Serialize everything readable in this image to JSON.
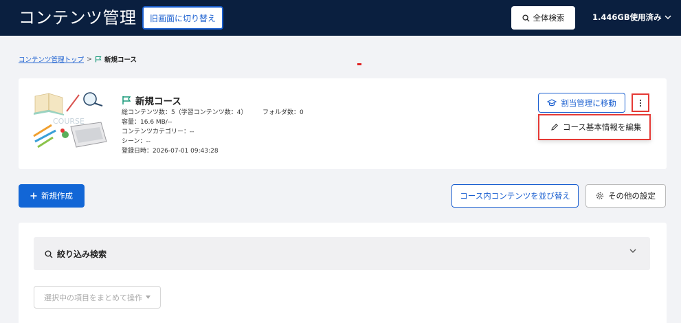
{
  "header": {
    "title": "コンテンツ管理",
    "old_ui_button": "旧画面に切り替え",
    "search_button": "全体検索",
    "usage": "1.446GB使用済み"
  },
  "breadcrumb": {
    "top": "コンテンツ管理トップ",
    "separator": ">",
    "current": "新規コース"
  },
  "course": {
    "name": "新規コース",
    "total_contents": "総コンテンツ数：5（学習コンテンツ数：4）",
    "folders": "フォルダ数：0",
    "capacity": "容量：16.6 MB/--",
    "category": "コンテンツカテゴリー：--",
    "scene": "シーン：--",
    "registered": "登録日時：2026-07-01 09:43:28",
    "thumbnail_text": "COURSE",
    "assign_button": "割当管理に移動",
    "menu_item_edit": "コース基本情報を編集"
  },
  "actions": {
    "new_button": "新規作成",
    "reorder_button": "コース内コンテンツを並び替え",
    "other_settings_button": "その他の設定"
  },
  "filter": {
    "label": "絞り込み検索",
    "bulk_action": "選択中の項目をまとめて操作"
  },
  "colors": {
    "header_bg": "#0a1f3f",
    "primary": "#1266d6",
    "highlight": "#e53935",
    "flag": "#1a9a7a"
  }
}
